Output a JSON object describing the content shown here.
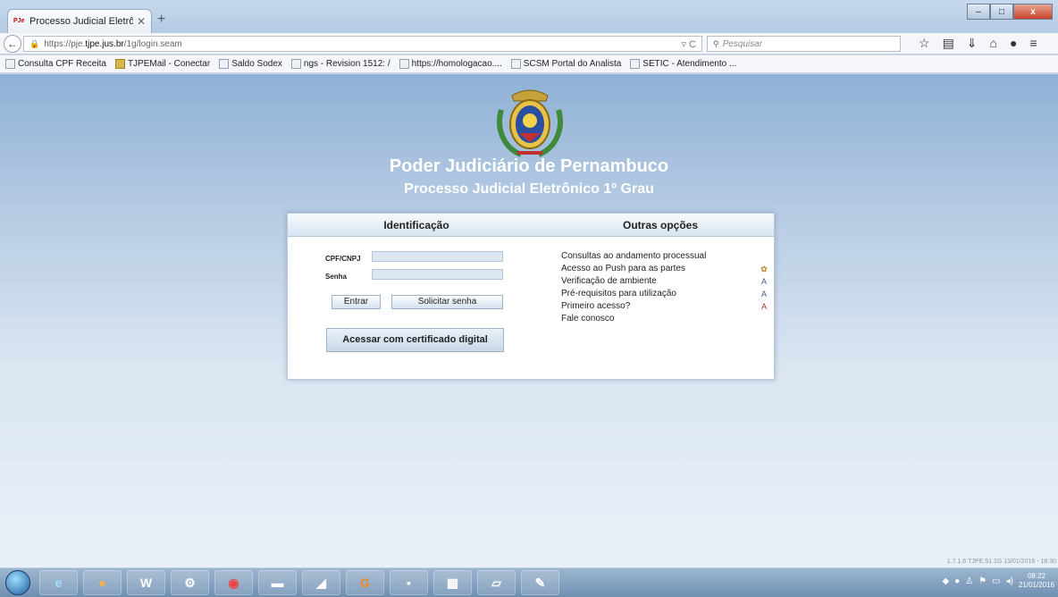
{
  "browser": {
    "tab_title": "Processo Judicial Eletrônic...",
    "tab_favicon": "PJe",
    "url_prefix": "https://pje.",
    "url_domain": "tjpe.jus.br",
    "url_path": "/1g/login.seam",
    "search_placeholder": "Pesquisar",
    "bookmarks": [
      "Consulta CPF Receita",
      "TJPEMail - Conectar",
      "Saldo Sodex",
      "ngs - Revision 1512: /",
      "https://homologacao....",
      "SCSM Portal do Analista",
      "SETIC - Atendimento ..."
    ]
  },
  "page": {
    "title": "Poder Judiciário de Pernambuco",
    "subtitle": "Processo Judicial Eletrônico 1º Grau",
    "login": {
      "heading": "Identificação",
      "cpf_label": "CPF/CNPJ",
      "password_label": "Senha",
      "enter_button": "Entrar",
      "request_password_button": "Solicitar senha",
      "certificate_button": "Acessar com certificado digital"
    },
    "options": {
      "heading": "Outras opções",
      "items": [
        "Consultas ao andamento processual",
        "Acesso ao Push para as partes",
        "Verificação de ambiente",
        "Pré-requisitos para utilização",
        "Primeiro acesso?",
        "Fale conosco"
      ]
    },
    "version": "1.7.1.6.TJPE.51.1G 13/01/2016 - 18:30"
  },
  "taskbar": {
    "time": "08:22",
    "date": "21/01/2016"
  }
}
